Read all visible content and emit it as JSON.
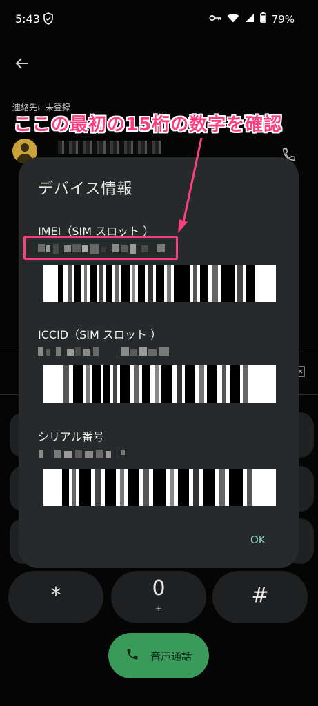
{
  "status_bar": {
    "time": "5:43",
    "battery": "79%",
    "icons": [
      "shield-icon",
      "vpn-key-icon",
      "wifi-icon",
      "signal-icon",
      "battery-icon"
    ]
  },
  "contact": {
    "label": "連絡先に未登録"
  },
  "annotation": {
    "text": "ここの最初の15桁の数字を確認",
    "color": "#ff3e7f"
  },
  "dialog": {
    "title": "デバイス情報",
    "sections": [
      {
        "label": "IMEI（SIM スロット ）"
      },
      {
        "label": "ICCID（SIM スロット ）"
      },
      {
        "label": "シリアル番号"
      }
    ],
    "ok_label": "OK"
  },
  "keypad": {
    "star": "*",
    "zero": "0",
    "zero_sub": "+",
    "hash": "#"
  },
  "call_button": {
    "label": "音声通話",
    "color": "#3a9a5a"
  }
}
